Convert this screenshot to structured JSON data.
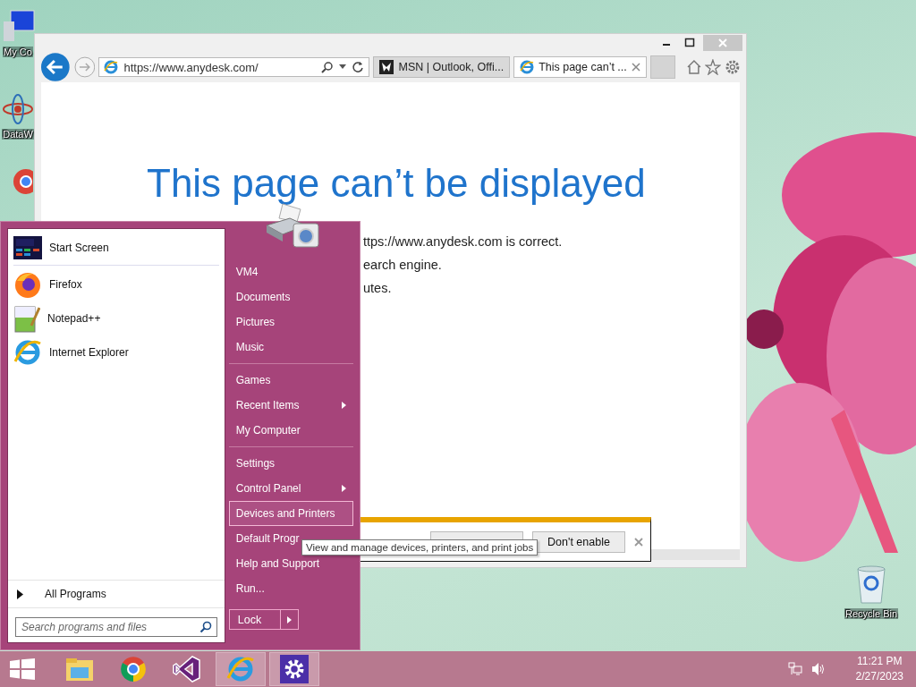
{
  "desktop_icons": [
    {
      "label": "My Co",
      "kind": "computer"
    },
    {
      "label": "DataW",
      "kind": "data"
    },
    {
      "label": "Recycle Bin",
      "kind": "bin"
    }
  ],
  "browser": {
    "url": "https://www.anydesk.com/",
    "tabs": [
      {
        "title": "MSN | Outlook, Offi...",
        "kind": "msn",
        "selected": false
      },
      {
        "title": "This page can’t ...",
        "kind": "ie",
        "selected": true
      }
    ],
    "heading": "This page can’t be displayed",
    "lines": [
      "ttps://www.anydesk.com is correct.",
      "earch engine.",
      "utes."
    ],
    "notification": {
      "button": "Don't enable"
    }
  },
  "start_menu": {
    "pinned": [
      {
        "label": "Start Screen",
        "kind": "start"
      },
      {
        "label": "Firefox",
        "kind": "firefox"
      },
      {
        "label": "Notepad++",
        "kind": "notepad"
      },
      {
        "label": "Internet Explorer",
        "kind": "ie"
      }
    ],
    "all_programs": "All Programs",
    "search_placeholder": "Search programs and files",
    "place_groups": [
      {
        "items": [
          {
            "label": "VM4",
            "has_submenu": false,
            "selected": false
          },
          {
            "label": "Documents",
            "has_submenu": false,
            "selected": false
          },
          {
            "label": "Pictures",
            "has_submenu": false,
            "selected": false
          },
          {
            "label": "Music",
            "has_submenu": false,
            "selected": false
          }
        ]
      },
      {
        "items": [
          {
            "label": "Games",
            "has_submenu": false,
            "selected": false
          },
          {
            "label": "Recent Items",
            "has_submenu": true,
            "selected": false
          },
          {
            "label": "My Computer",
            "has_submenu": false,
            "selected": false
          }
        ]
      },
      {
        "items": [
          {
            "label": "Settings",
            "has_submenu": false,
            "selected": false
          },
          {
            "label": "Control Panel",
            "has_submenu": true,
            "selected": false
          },
          {
            "label": "Devices and Printers",
            "has_submenu": false,
            "selected": true
          },
          {
            "label": "Default Progr",
            "has_submenu": false,
            "selected": false
          },
          {
            "label": "Help and Support",
            "has_submenu": false,
            "selected": false
          },
          {
            "label": "Run...",
            "has_submenu": false,
            "selected": false
          }
        ]
      }
    ],
    "lock": "Lock",
    "tooltip": "View and manage devices, printers, and print jobs"
  },
  "taskbar": {
    "items": [
      {
        "kind": "explorer",
        "active": false
      },
      {
        "kind": "chrome",
        "active": false
      },
      {
        "kind": "vs",
        "active": false
      },
      {
        "kind": "ie",
        "active": true
      },
      {
        "kind": "settings",
        "active": true
      }
    ],
    "time": "11:21 PM",
    "date": "2/27/2023"
  }
}
